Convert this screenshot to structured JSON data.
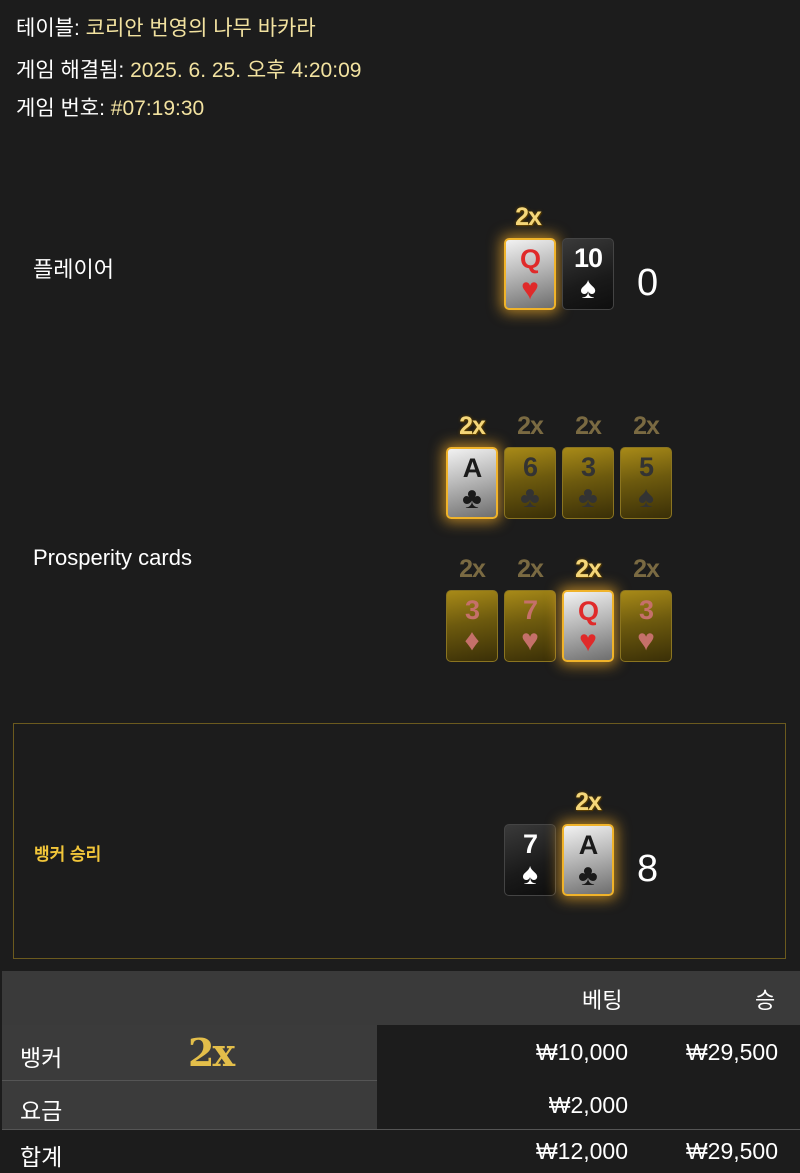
{
  "meta": {
    "table_label": "테이블:",
    "table_value": "코리안 번영의 나무 바카라",
    "resolved_label": "게임 해결됨:",
    "resolved_value": "2025. 6. 25. 오후 4:20:09",
    "game_no_label": "게임 번호:",
    "game_no_value": "#07:19:30"
  },
  "player": {
    "label": "플레이어",
    "score": "0",
    "cards": [
      {
        "rank": "Q",
        "suit": "♥",
        "multiplier": "2x"
      },
      {
        "rank": "10",
        "suit": "♠"
      }
    ]
  },
  "prosperity": {
    "label": "Prosperity cards",
    "row1": [
      {
        "rank": "A",
        "suit": "♣",
        "multiplier": "2x",
        "active": true
      },
      {
        "rank": "6",
        "suit": "♣",
        "multiplier": "2x",
        "active": false
      },
      {
        "rank": "3",
        "suit": "♣",
        "multiplier": "2x",
        "active": false
      },
      {
        "rank": "5",
        "suit": "♠",
        "multiplier": "2x",
        "active": false
      }
    ],
    "row2": [
      {
        "rank": "3",
        "suit": "♦",
        "multiplier": "2x",
        "active": false
      },
      {
        "rank": "7",
        "suit": "♥",
        "multiplier": "2x",
        "active": false
      },
      {
        "rank": "Q",
        "suit": "♥",
        "multiplier": "2x",
        "active": true
      },
      {
        "rank": "3",
        "suit": "♥",
        "multiplier": "2x",
        "active": false
      }
    ]
  },
  "banker": {
    "result": "뱅커 승리",
    "score": "8",
    "cards": [
      {
        "rank": "7",
        "suit": "♠"
      },
      {
        "rank": "A",
        "suit": "♣",
        "multiplier": "2x"
      }
    ]
  },
  "table": {
    "headers": {
      "bet": "베팅",
      "win": "승"
    },
    "rows": [
      {
        "name": "뱅커",
        "badge": "2x",
        "bet": "₩10,000",
        "win": "₩29,500"
      },
      {
        "name": "요금",
        "bet": "₩2,000",
        "win": ""
      },
      {
        "name": "합계",
        "bet": "₩12,000",
        "win": "₩29,500"
      }
    ]
  },
  "colors": {
    "accent_gold": "#f2c63a",
    "background": "#1c1c1c"
  }
}
